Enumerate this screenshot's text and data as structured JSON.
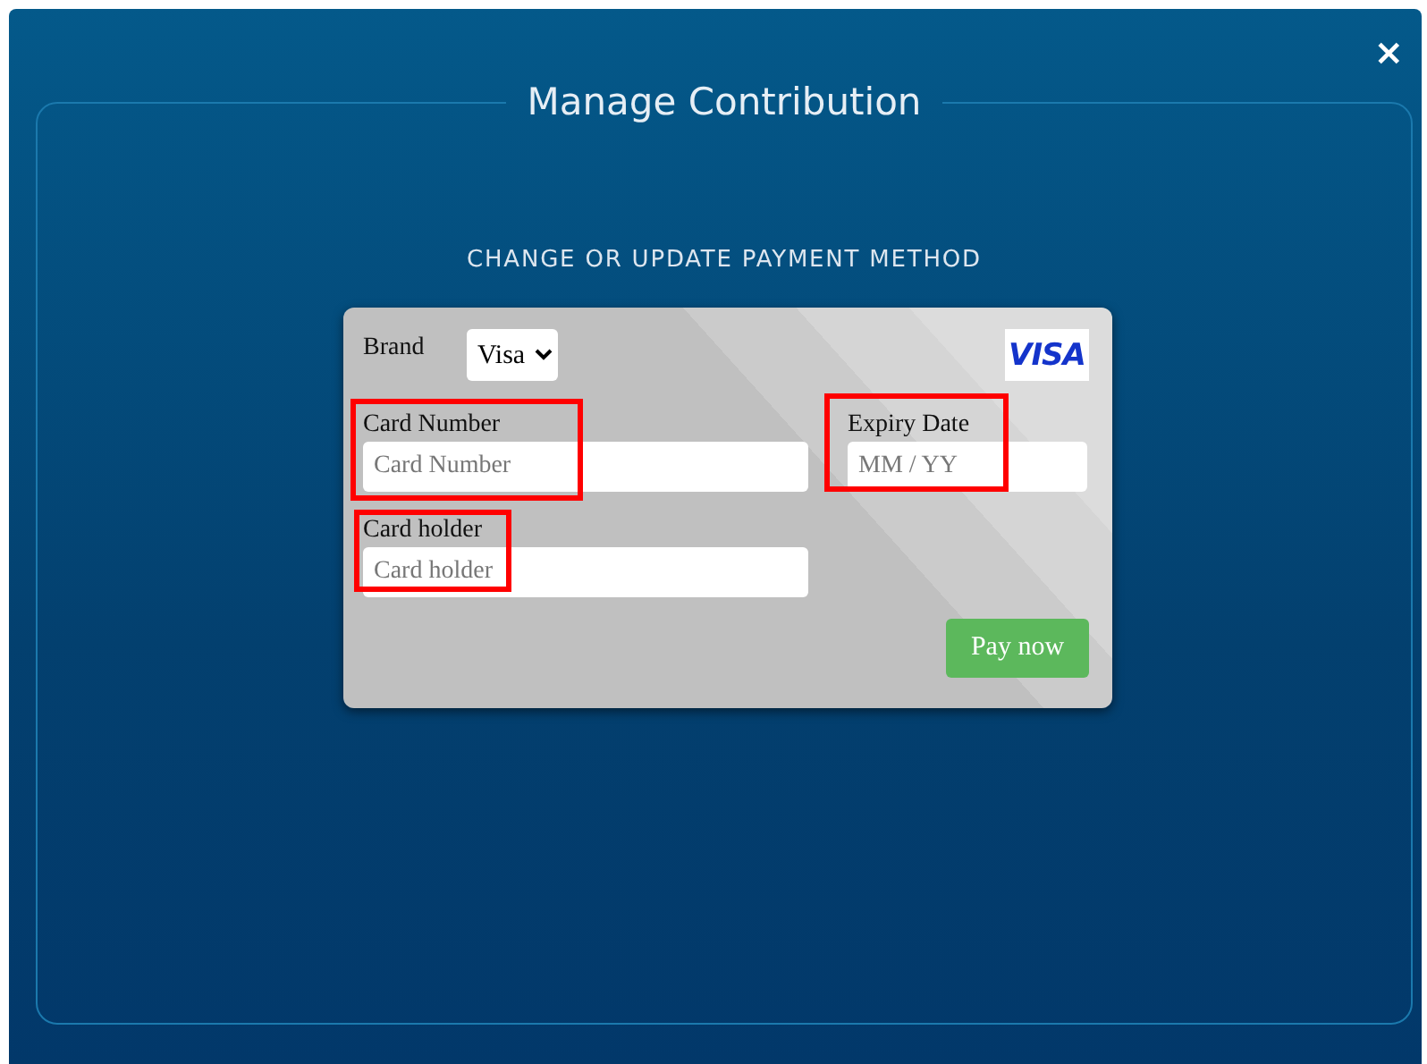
{
  "dialog": {
    "title": "Manage Contribution",
    "close": "×",
    "subtitle": "CHANGE OR UPDATE PAYMENT METHOD"
  },
  "card": {
    "brand": {
      "label": "Brand",
      "value": "Visa"
    },
    "logo": "VISA",
    "fields": [
      {
        "kind": "number",
        "label": "Card Number",
        "placeholder": "Card Number",
        "highlighted": true
      },
      {
        "kind": "expiry",
        "label": "Expiry Date",
        "placeholder": "MM / YY",
        "highlighted": true
      },
      {
        "kind": "holder",
        "label": "Card holder",
        "placeholder": "Card holder",
        "highlighted": true
      }
    ],
    "button": "Pay now"
  }
}
